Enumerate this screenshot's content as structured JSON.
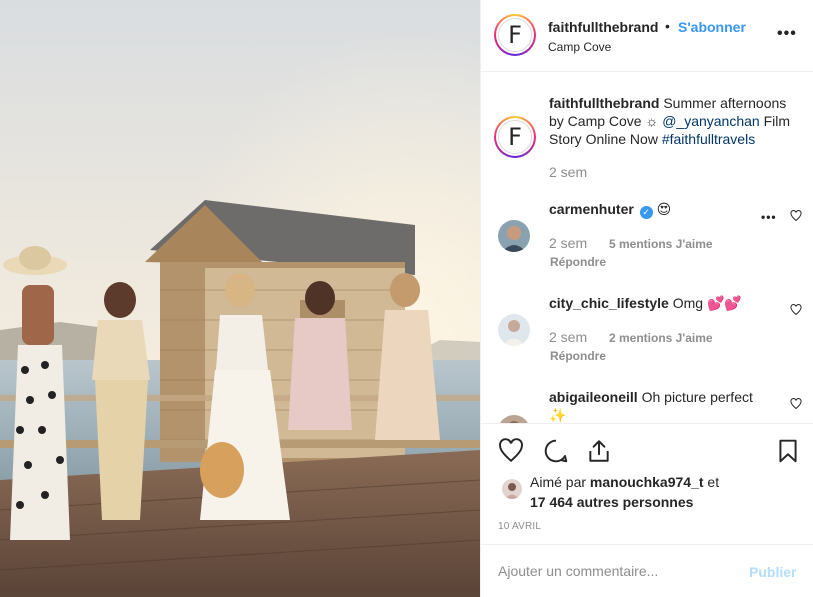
{
  "post": {
    "username": "faithfullthebrand",
    "follow_label": "S'abonner",
    "dot": "•",
    "location": "Camp Cove",
    "more_label": "•••",
    "avatar_letter": "F"
  },
  "caption": {
    "username": "faithfullthebrand",
    "text_part1": "Summer afternoons by Camp Cove ☼ ",
    "mention": "@_yanyanchan",
    "text_part2": " Film Story Online Now ",
    "hashtag": "#faithfulltravels",
    "time": "2 sem"
  },
  "comments": [
    {
      "username": "carmenhuter",
      "verified": "✓",
      "text": "😍",
      "time": "2 sem",
      "likes": "5 mentions J'aime",
      "reply": "Répondre",
      "more": "•••"
    },
    {
      "username": "city_chic_lifestyle",
      "text": "Omg 💕💕",
      "time": "2 sem",
      "likes": "2 mentions J'aime",
      "reply": "Répondre"
    },
    {
      "username": "abigaileoneill",
      "text": "Oh picture perfect ✨"
    }
  ],
  "likes": {
    "prefix": "Aimé par",
    "user": "manouchka974_t",
    "suffix": "et",
    "others": "17 464 autres personnes"
  },
  "date": "10 AVRIL",
  "add_comment": {
    "placeholder": "Ajouter un commentaire...",
    "publish_label": "Publier"
  },
  "colors": {
    "link_blue": "#3897f0",
    "hashtag_blue": "#003569",
    "muted": "#8e8e8e",
    "publish_disabled": "#b2dffc"
  }
}
